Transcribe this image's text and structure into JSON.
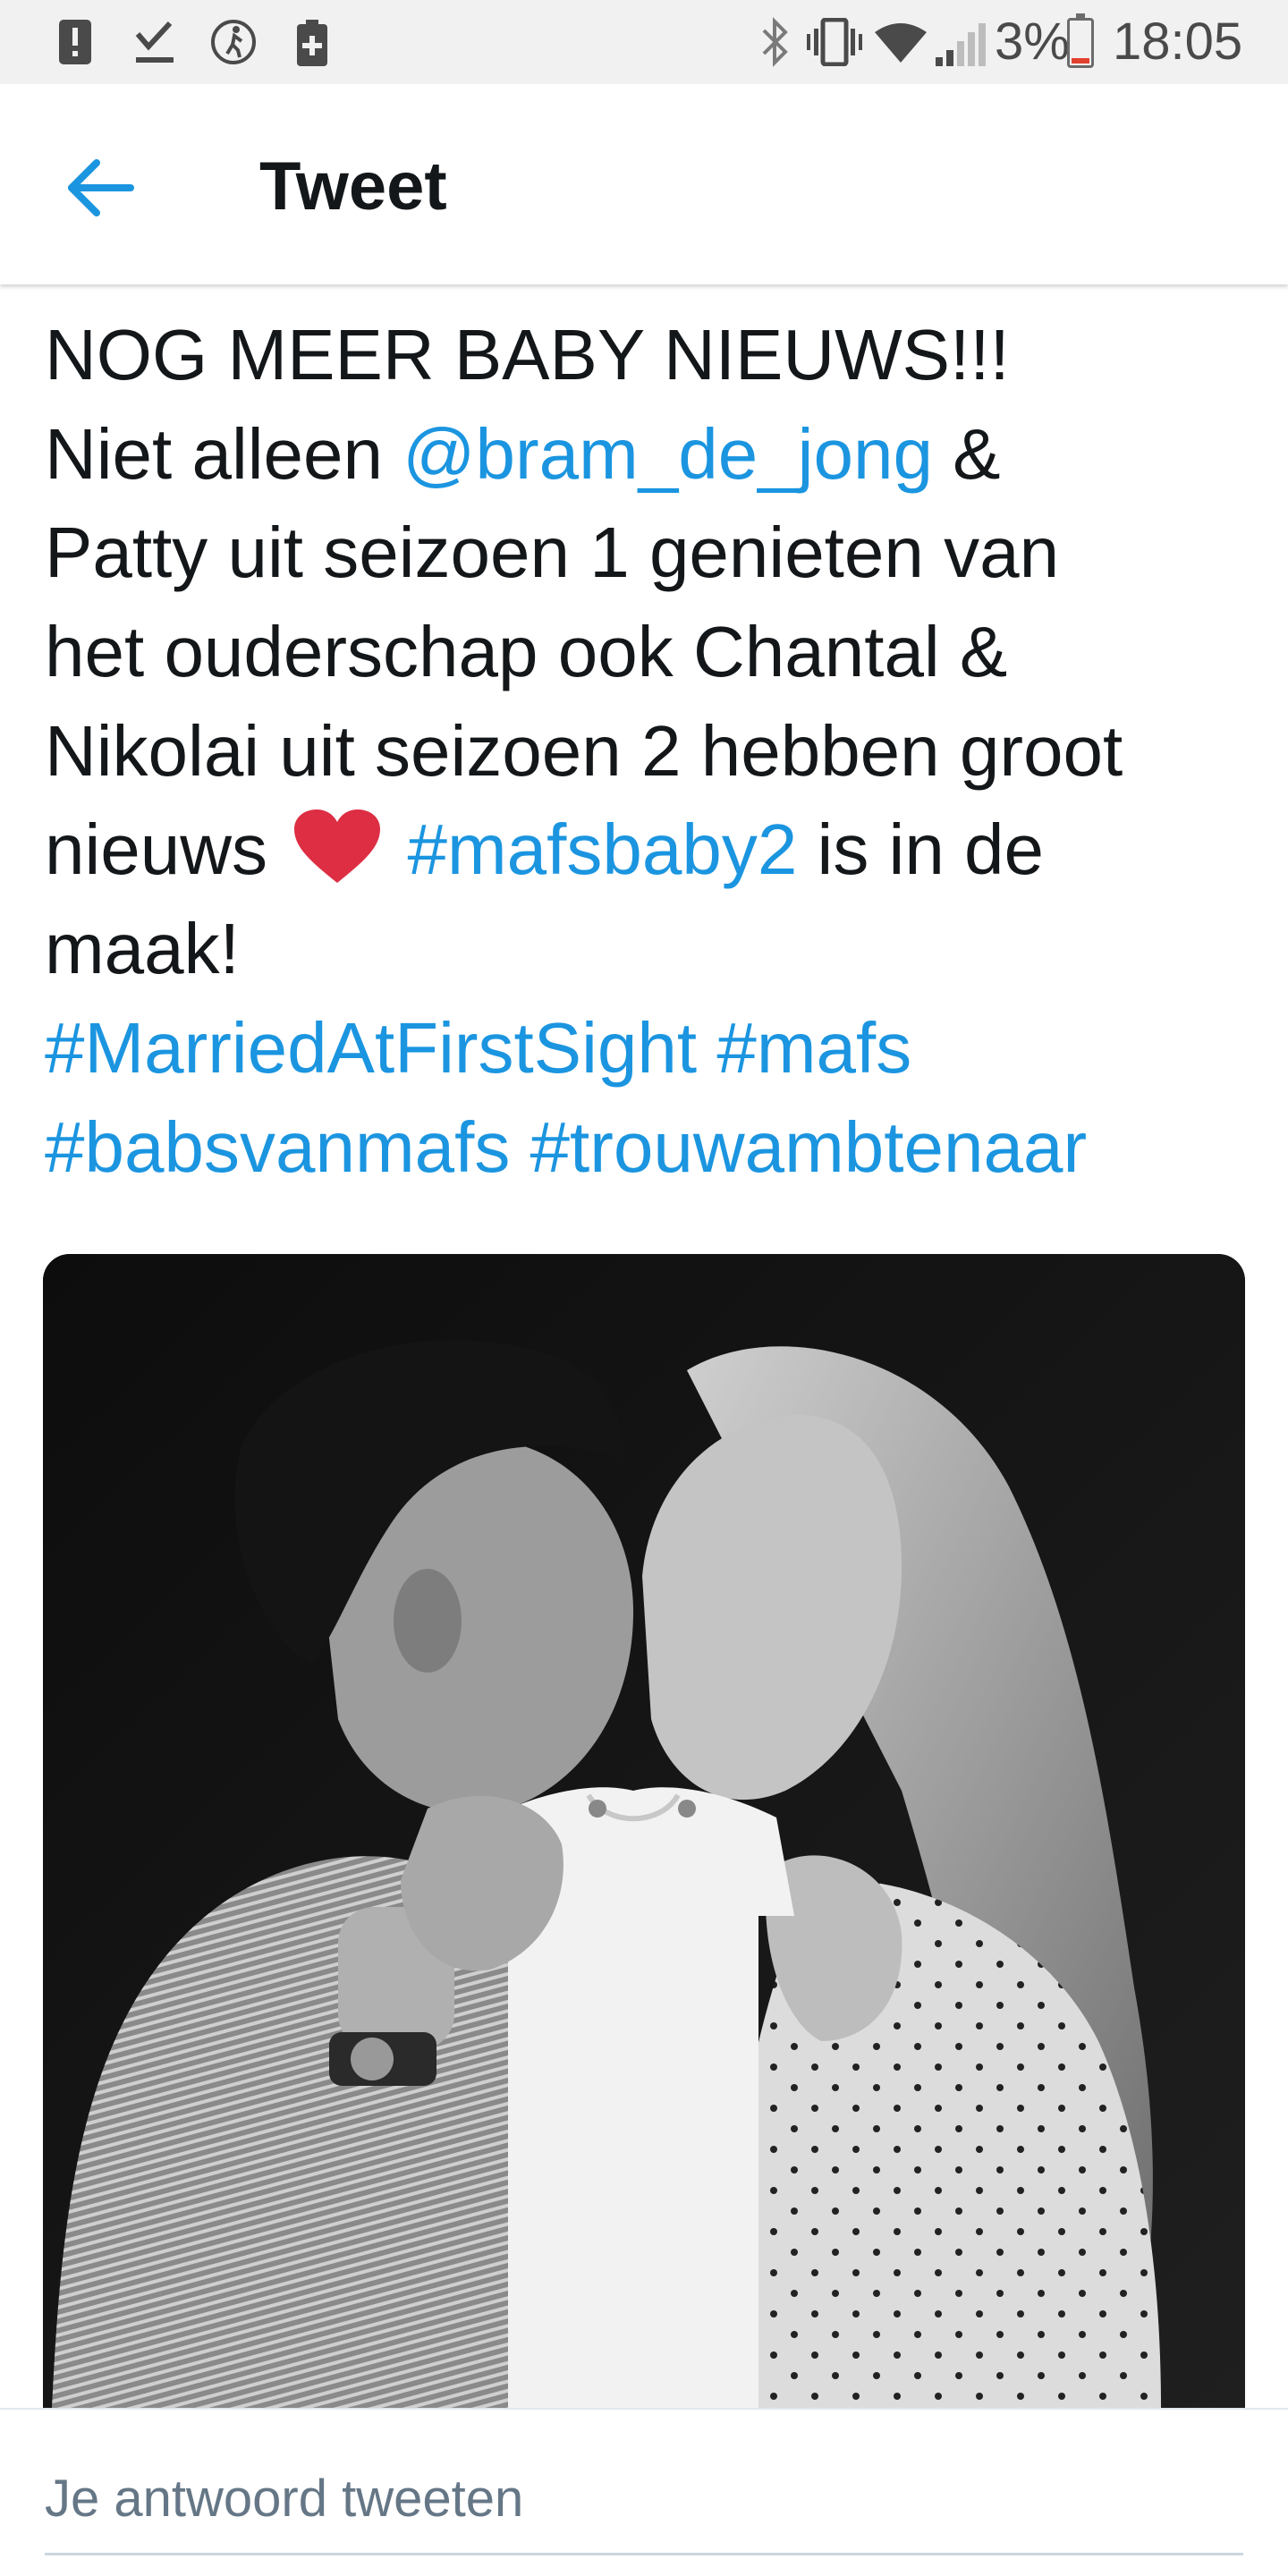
{
  "status_bar": {
    "left_icons": [
      "alert-icon",
      "download-done-icon",
      "running-icon",
      "battery-saver-icon"
    ],
    "right_icons": [
      "bluetooth-icon",
      "vibrate-icon",
      "wifi-icon",
      "cell-signal-icon",
      "battery-icon"
    ],
    "battery_percent": "3%",
    "battery_level": 0.03,
    "battery_color": "#e2412f",
    "time": "18:05"
  },
  "app_bar": {
    "back_icon": "arrow-left-icon",
    "title": "Tweet",
    "accent_color": "#1b95e0"
  },
  "tweet": {
    "lines": [
      [
        {
          "t": "NOG MEER BABY NIEUWS!!!"
        }
      ],
      [
        {
          "t": "Niet alleen "
        },
        {
          "t": "@bram_de_jong",
          "link": true,
          "kind": "mention"
        },
        {
          "t": " &"
        }
      ],
      [
        {
          "t": "Patty uit seizoen 1 genieten van"
        }
      ],
      [
        {
          "t": "het ouderschap ook Chantal &"
        }
      ],
      [
        {
          "t": "Nikolai uit seizoen 2 hebben groot"
        }
      ],
      [
        {
          "t": "nieuws "
        },
        {
          "emoji": "heart-icon"
        },
        {
          "t": " "
        },
        {
          "t": "#mafsbaby2",
          "link": true,
          "kind": "hashtag"
        },
        {
          "t": " is in de"
        }
      ],
      [
        {
          "t": "maak!"
        }
      ],
      [
        {
          "t": "#MarriedAtFirstSight",
          "link": true,
          "kind": "hashtag"
        },
        {
          "t": " "
        },
        {
          "t": "#mafs",
          "link": true,
          "kind": "hashtag"
        }
      ],
      [
        {
          "t": "#babsvanmafs",
          "link": true,
          "kind": "hashtag"
        },
        {
          "t": " "
        },
        {
          "t": "#trouwambtenaar",
          "link": true,
          "kind": "hashtag"
        }
      ]
    ],
    "text_color": "#14171a",
    "link_color": "#1b95e0"
  },
  "media": {
    "kind": "photo",
    "style": "black-and-white"
  },
  "reply": {
    "placeholder": "Je antwoord tweeten",
    "value": ""
  }
}
